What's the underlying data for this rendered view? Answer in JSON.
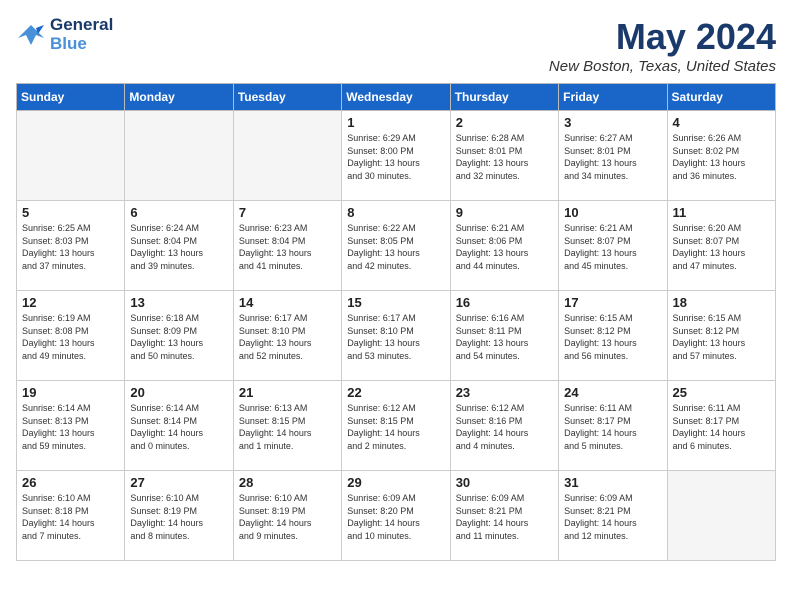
{
  "header": {
    "logo_line1": "General",
    "logo_line2": "Blue",
    "month": "May 2024",
    "location": "New Boston, Texas, United States"
  },
  "days_of_week": [
    "Sunday",
    "Monday",
    "Tuesday",
    "Wednesday",
    "Thursday",
    "Friday",
    "Saturday"
  ],
  "weeks": [
    [
      {
        "day": "",
        "info": ""
      },
      {
        "day": "",
        "info": ""
      },
      {
        "day": "",
        "info": ""
      },
      {
        "day": "1",
        "info": "Sunrise: 6:29 AM\nSunset: 8:00 PM\nDaylight: 13 hours\nand 30 minutes."
      },
      {
        "day": "2",
        "info": "Sunrise: 6:28 AM\nSunset: 8:01 PM\nDaylight: 13 hours\nand 32 minutes."
      },
      {
        "day": "3",
        "info": "Sunrise: 6:27 AM\nSunset: 8:01 PM\nDaylight: 13 hours\nand 34 minutes."
      },
      {
        "day": "4",
        "info": "Sunrise: 6:26 AM\nSunset: 8:02 PM\nDaylight: 13 hours\nand 36 minutes."
      }
    ],
    [
      {
        "day": "5",
        "info": "Sunrise: 6:25 AM\nSunset: 8:03 PM\nDaylight: 13 hours\nand 37 minutes."
      },
      {
        "day": "6",
        "info": "Sunrise: 6:24 AM\nSunset: 8:04 PM\nDaylight: 13 hours\nand 39 minutes."
      },
      {
        "day": "7",
        "info": "Sunrise: 6:23 AM\nSunset: 8:04 PM\nDaylight: 13 hours\nand 41 minutes."
      },
      {
        "day": "8",
        "info": "Sunrise: 6:22 AM\nSunset: 8:05 PM\nDaylight: 13 hours\nand 42 minutes."
      },
      {
        "day": "9",
        "info": "Sunrise: 6:21 AM\nSunset: 8:06 PM\nDaylight: 13 hours\nand 44 minutes."
      },
      {
        "day": "10",
        "info": "Sunrise: 6:21 AM\nSunset: 8:07 PM\nDaylight: 13 hours\nand 45 minutes."
      },
      {
        "day": "11",
        "info": "Sunrise: 6:20 AM\nSunset: 8:07 PM\nDaylight: 13 hours\nand 47 minutes."
      }
    ],
    [
      {
        "day": "12",
        "info": "Sunrise: 6:19 AM\nSunset: 8:08 PM\nDaylight: 13 hours\nand 49 minutes."
      },
      {
        "day": "13",
        "info": "Sunrise: 6:18 AM\nSunset: 8:09 PM\nDaylight: 13 hours\nand 50 minutes."
      },
      {
        "day": "14",
        "info": "Sunrise: 6:17 AM\nSunset: 8:10 PM\nDaylight: 13 hours\nand 52 minutes."
      },
      {
        "day": "15",
        "info": "Sunrise: 6:17 AM\nSunset: 8:10 PM\nDaylight: 13 hours\nand 53 minutes."
      },
      {
        "day": "16",
        "info": "Sunrise: 6:16 AM\nSunset: 8:11 PM\nDaylight: 13 hours\nand 54 minutes."
      },
      {
        "day": "17",
        "info": "Sunrise: 6:15 AM\nSunset: 8:12 PM\nDaylight: 13 hours\nand 56 minutes."
      },
      {
        "day": "18",
        "info": "Sunrise: 6:15 AM\nSunset: 8:12 PM\nDaylight: 13 hours\nand 57 minutes."
      }
    ],
    [
      {
        "day": "19",
        "info": "Sunrise: 6:14 AM\nSunset: 8:13 PM\nDaylight: 13 hours\nand 59 minutes."
      },
      {
        "day": "20",
        "info": "Sunrise: 6:14 AM\nSunset: 8:14 PM\nDaylight: 14 hours\nand 0 minutes."
      },
      {
        "day": "21",
        "info": "Sunrise: 6:13 AM\nSunset: 8:15 PM\nDaylight: 14 hours\nand 1 minute."
      },
      {
        "day": "22",
        "info": "Sunrise: 6:12 AM\nSunset: 8:15 PM\nDaylight: 14 hours\nand 2 minutes."
      },
      {
        "day": "23",
        "info": "Sunrise: 6:12 AM\nSunset: 8:16 PM\nDaylight: 14 hours\nand 4 minutes."
      },
      {
        "day": "24",
        "info": "Sunrise: 6:11 AM\nSunset: 8:17 PM\nDaylight: 14 hours\nand 5 minutes."
      },
      {
        "day": "25",
        "info": "Sunrise: 6:11 AM\nSunset: 8:17 PM\nDaylight: 14 hours\nand 6 minutes."
      }
    ],
    [
      {
        "day": "26",
        "info": "Sunrise: 6:10 AM\nSunset: 8:18 PM\nDaylight: 14 hours\nand 7 minutes."
      },
      {
        "day": "27",
        "info": "Sunrise: 6:10 AM\nSunset: 8:19 PM\nDaylight: 14 hours\nand 8 minutes."
      },
      {
        "day": "28",
        "info": "Sunrise: 6:10 AM\nSunset: 8:19 PM\nDaylight: 14 hours\nand 9 minutes."
      },
      {
        "day": "29",
        "info": "Sunrise: 6:09 AM\nSunset: 8:20 PM\nDaylight: 14 hours\nand 10 minutes."
      },
      {
        "day": "30",
        "info": "Sunrise: 6:09 AM\nSunset: 8:21 PM\nDaylight: 14 hours\nand 11 minutes."
      },
      {
        "day": "31",
        "info": "Sunrise: 6:09 AM\nSunset: 8:21 PM\nDaylight: 14 hours\nand 12 minutes."
      },
      {
        "day": "",
        "info": ""
      }
    ]
  ]
}
